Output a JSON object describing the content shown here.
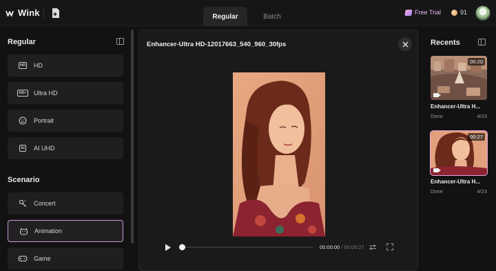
{
  "app": {
    "name": "Wink"
  },
  "tabs": [
    {
      "label": "Regular",
      "active": true
    },
    {
      "label": "Batch",
      "active": false
    }
  ],
  "header": {
    "free_trial": "Free Trial",
    "coins": "91"
  },
  "sidebar": {
    "sections": [
      {
        "title": "Regular",
        "items": [
          {
            "label": "HD",
            "icon": "hd-icon"
          },
          {
            "label": "Ultra HD",
            "icon": "hd-plus-icon"
          },
          {
            "label": "Portrait",
            "icon": "smile-icon"
          },
          {
            "label": "AI UHD",
            "icon": "ai-uhd-icon"
          }
        ]
      },
      {
        "title": "Scenario",
        "items": [
          {
            "label": "Concert",
            "icon": "concert-icon"
          },
          {
            "label": "Animation",
            "icon": "animation-icon",
            "active": true
          },
          {
            "label": "Game",
            "icon": "gamepad-icon"
          }
        ]
      }
    ]
  },
  "preview": {
    "title": "Enhancer-Ultra HD-12017663_540_960_30fps",
    "current_time": "00:00:00",
    "duration": "00:00:27"
  },
  "recents": {
    "title": "Recents",
    "items": [
      {
        "name": "Enhancer-Ultra H...",
        "duration": "00:20",
        "status": "Done",
        "date": "4/23",
        "selected": false
      },
      {
        "name": "Enhancer-Ultra H...",
        "duration": "00:27",
        "status": "Done",
        "date": "4/23",
        "selected": true
      }
    ]
  },
  "colors": {
    "accent": "#c99ad6",
    "background": "#121212",
    "panel": "#1a1a1a"
  }
}
